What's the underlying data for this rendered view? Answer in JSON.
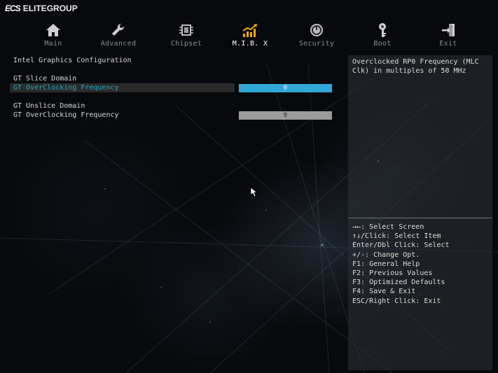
{
  "brand": {
    "mark": "ECS",
    "name": "ELITEGROUP"
  },
  "tabs": [
    {
      "label": "Main",
      "icon": "home-icon",
      "active": false
    },
    {
      "label": "Advanced",
      "icon": "wrench-icon",
      "active": false
    },
    {
      "label": "Chipset",
      "icon": "chip-icon",
      "active": false
    },
    {
      "label": "M.I.B. X",
      "icon": "chart-icon",
      "active": true
    },
    {
      "label": "Security",
      "icon": "power-icon",
      "active": false
    },
    {
      "label": "Boot",
      "icon": "key-icon",
      "active": false
    },
    {
      "label": "Exit",
      "icon": "exit-icon",
      "active": false
    }
  ],
  "colors": {
    "accent": "#30a7d6",
    "highlight_text": "#27a6cc",
    "mib_icon": "#f0a800"
  },
  "main": {
    "section_title": "Intel Graphics Configuration",
    "slice_heading": "GT Slice Domain",
    "slice_label": "GT OverClocking Frequency",
    "slice_value": "0",
    "unslice_heading": "GT Unslice Domain",
    "unslice_label": "GT OverClocking Frequency",
    "unslice_value": "0"
  },
  "help": {
    "description": "Overclocked RP0 Frequency (MLC Clk) in multiples of 50 MHz",
    "keys": [
      "→←: Select Screen",
      "↑↓/Click: Select Item",
      "Enter/Dbl Click: Select",
      "+/-: Change Opt.",
      "F1: General Help",
      "F2: Previous Values",
      "F3: Optimized Defaults",
      "F4: Save & Exit",
      "ESC/Right Click: Exit"
    ]
  }
}
